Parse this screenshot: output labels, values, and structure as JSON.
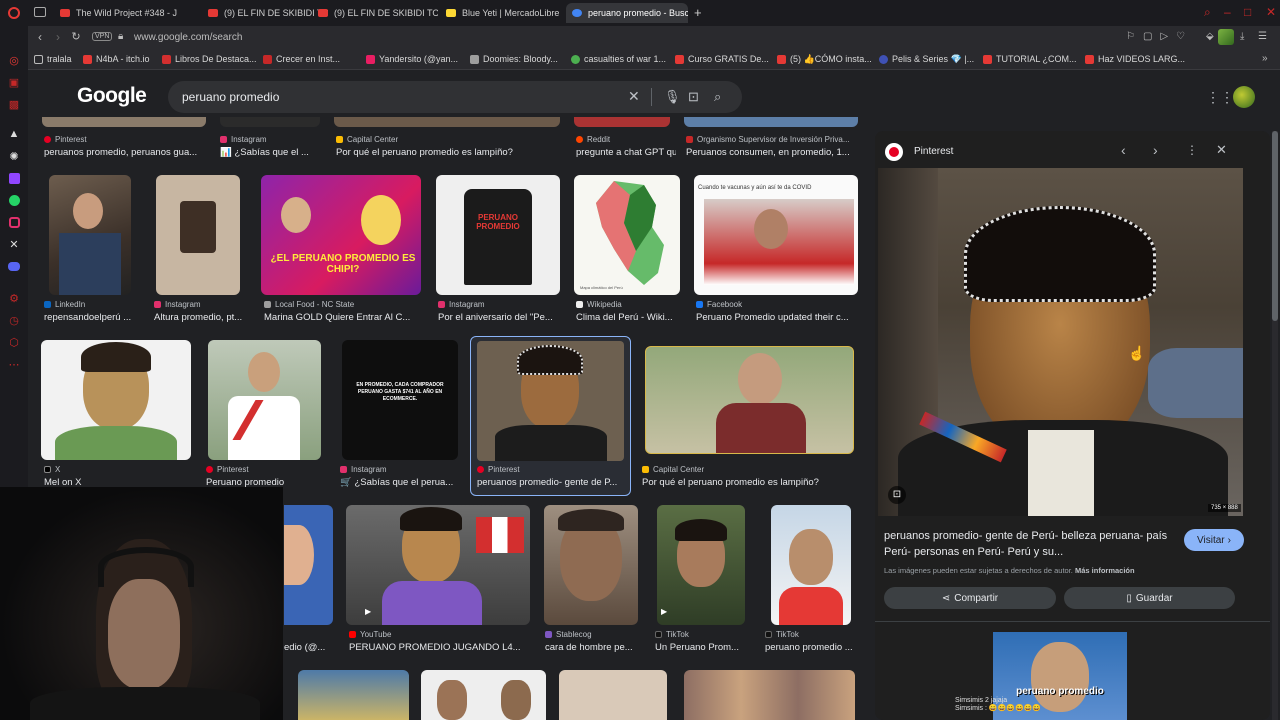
{
  "tabs": [
    {
      "label": "The Wild Project #348 - J",
      "color": "#e53935"
    },
    {
      "label": "(9) EL FIN DE SKIBIDI TO",
      "color": "#e53935"
    },
    {
      "label": "(9) EL FIN DE SKIBIDI TO",
      "color": "#e53935"
    },
    {
      "label": "Blue Yeti | MercadoLibre",
      "color": "#fdd835"
    },
    {
      "label": "peruano promedio - Busc",
      "color": "#4285f4"
    }
  ],
  "address": {
    "vpn": "VPN",
    "url": "www.google.com/search"
  },
  "bookmarks": [
    {
      "label": "tralala",
      "color": "#bbbbbb"
    },
    {
      "label": "N4bA - itch.io",
      "color": "#e53935"
    },
    {
      "label": "Libros De Destaca...",
      "color": "#d32f2f"
    },
    {
      "label": "Crecer en Inst...",
      "color": "#c62828"
    },
    {
      "label": "Yandersito (@yan...",
      "color": "#e91e63"
    },
    {
      "label": "Doomies: Bloody...",
      "color": "#9e9e9e"
    },
    {
      "label": "casualties of war 1...",
      "color": "#4caf50"
    },
    {
      "label": "Curso GRATIS De...",
      "color": "#e53935"
    },
    {
      "label": "(5) 👍CÓMO insta...",
      "color": "#e53935"
    },
    {
      "label": "Pelis & Series 💎 |...",
      "color": "#3f51b5"
    },
    {
      "label": "TUTORIAL ¿COM...",
      "color": "#e53935"
    },
    {
      "label": "Haz VIDEOS LARG...",
      "color": "#e53935"
    }
  ],
  "google": {
    "logo": "Google",
    "query": "peruano promedio"
  },
  "results": [
    {
      "source": "Pinterest",
      "title": "peruanos promedio, peruanos gua...",
      "fav": "#e60023"
    },
    {
      "source": "Instagram",
      "title": "📊 ¿Sabías que el ...",
      "fav": "#e1306c"
    },
    {
      "source": "Capital Center",
      "title": "Por qué el peruano promedio es lampiño?",
      "fav": "#fbbc04"
    },
    {
      "source": "Reddit",
      "title": "pregunte a chat GPT que...",
      "fav": "#ff4500"
    },
    {
      "source": "Organismo Supervisor de Inversión Priva...",
      "title": "Peruanos consumen, en promedio, 1...",
      "fav": "#c62828"
    },
    {
      "source": "LinkedIn",
      "title": "repensandoelperú ...",
      "fav": "#0a66c2"
    },
    {
      "source": "Instagram",
      "title": "Altura promedio, pt...",
      "fav": "#e1306c"
    },
    {
      "source": "Local Food - NC State",
      "title": "Marina GOLD Quiere Entrar Al C...",
      "fav": "#9e9e9e"
    },
    {
      "source": "Instagram",
      "title": "Por el aniversario del \"Pe...",
      "fav": "#e1306c"
    },
    {
      "source": "Wikipedia",
      "title": "Clima del Perú - Wiki...",
      "fav": "#eeeeee"
    },
    {
      "source": "Facebook",
      "title": "Peruano Promedio updated their c...",
      "fav": "#1877f2"
    },
    {
      "source": "X",
      "title": "Mel on X",
      "fav": "#000000"
    },
    {
      "source": "Pinterest",
      "title": "Peruano promedio",
      "fav": "#e60023"
    },
    {
      "source": "Instagram",
      "title": "🛒 ¿Sabías que el perua...",
      "fav": "#e1306c"
    },
    {
      "source": "Pinterest",
      "title": "peruanos promedio- gente de P...",
      "fav": "#e60023"
    },
    {
      "source": "Capital Center",
      "title": "Por qué el peruano promedio es lampiño?",
      "fav": "#fbbc04"
    },
    {
      "source": "",
      "title": "edio (@...",
      "fav": ""
    },
    {
      "source": "YouTube",
      "title": "PERUANO PROMEDIO JUGANDO L4...",
      "fav": "#ff0000"
    },
    {
      "source": "Stablecog",
      "title": "cara de hombre pe...",
      "fav": "#7e57c2"
    },
    {
      "source": "TikTok",
      "title": "Un Peruano Prom...",
      "fav": "#111111"
    },
    {
      "source": "TikTok",
      "title": "peruano promedio ...",
      "fav": "#111111"
    }
  ],
  "thumb_texts": {
    "chipi": "¿EL PERUANO PROMEDIO ES CHIPI?",
    "shirt": "PERUANO PROMEDIO",
    "ecommerce": "EN PROMEDIO, CADA COMPRADOR PERUANO GASTA $741 AL AÑO EN ECOMMERCE.",
    "covid": "Cuando te vacunas y aún así te da COVID",
    "map_caption": "Mapa climático del Perú"
  },
  "panel": {
    "source": "Pinterest",
    "size": "735 × 888",
    "title": "peruanos promedio- gente de Perú- belleza peruana- país Perú- personas en Perú- Perú y su...",
    "notice": "Las imágenes pueden estar sujetas a derechos de autor.",
    "notice_link": "Más información",
    "visit": "Visitar",
    "share": "Compartir",
    "save": "Guardar",
    "caption_overlay": "peruano promedio"
  },
  "chat": [
    "Simsimis 2 jajaja",
    "Simsimis : 😄😄😄😄😄😄"
  ]
}
